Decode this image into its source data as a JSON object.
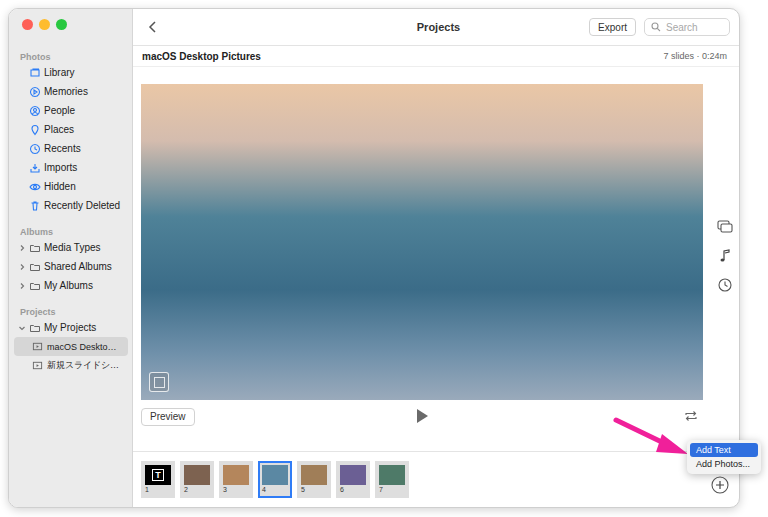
{
  "window": {
    "title": "Projects"
  },
  "toolbar": {
    "export": "Export",
    "search_placeholder": "Search"
  },
  "sidebar": [
    {
      "title": "Photos",
      "kind": "plain",
      "items": [
        {
          "label": "Library",
          "selected": false
        },
        {
          "label": "Memories",
          "selected": false
        },
        {
          "label": "People",
          "selected": false
        },
        {
          "label": "Places",
          "selected": false
        },
        {
          "label": "Recents",
          "selected": false
        },
        {
          "label": "Imports",
          "selected": false
        },
        {
          "label": "Hidden",
          "selected": false
        },
        {
          "label": "Recently Deleted",
          "selected": false
        }
      ]
    },
    {
      "title": "Albums",
      "kind": "folders",
      "items": [
        {
          "label": "Media Types",
          "expanded": false
        },
        {
          "label": "Shared Albums",
          "expanded": false
        },
        {
          "label": "My Albums",
          "expanded": false
        }
      ]
    },
    {
      "title": "Projects",
      "kind": "folders",
      "items": [
        {
          "label": "My Projects",
          "expanded": true,
          "children": [
            {
              "label": "macOS Deskto…",
              "selected": true
            },
            {
              "label": "新規スライドシ…",
              "selected": false
            }
          ]
        }
      ]
    }
  ],
  "project": {
    "name": "macOS Desktop Pictures",
    "meta": "7 slides · 0:24m"
  },
  "controls": {
    "preview": "Preview"
  },
  "slides": [
    {
      "number": "1",
      "kind": "text",
      "icon": "T",
      "selected": false,
      "color": "#000000"
    },
    {
      "number": "2",
      "kind": "photo",
      "selected": false,
      "color": "#7d6250"
    },
    {
      "number": "3",
      "kind": "photo",
      "selected": false,
      "color": "#b4865c"
    },
    {
      "number": "4",
      "kind": "photo",
      "selected": true,
      "color": "#5b88a3"
    },
    {
      "number": "5",
      "kind": "photo",
      "selected": false,
      "color": "#a07e58"
    },
    {
      "number": "6",
      "kind": "photo",
      "selected": false,
      "color": "#6b5f94"
    },
    {
      "number": "7",
      "kind": "photo",
      "selected": false,
      "color": "#4e7a68"
    }
  ],
  "menu": [
    {
      "label": "Add Text",
      "selected": true
    },
    {
      "label": "Add Photos...",
      "selected": false
    }
  ]
}
